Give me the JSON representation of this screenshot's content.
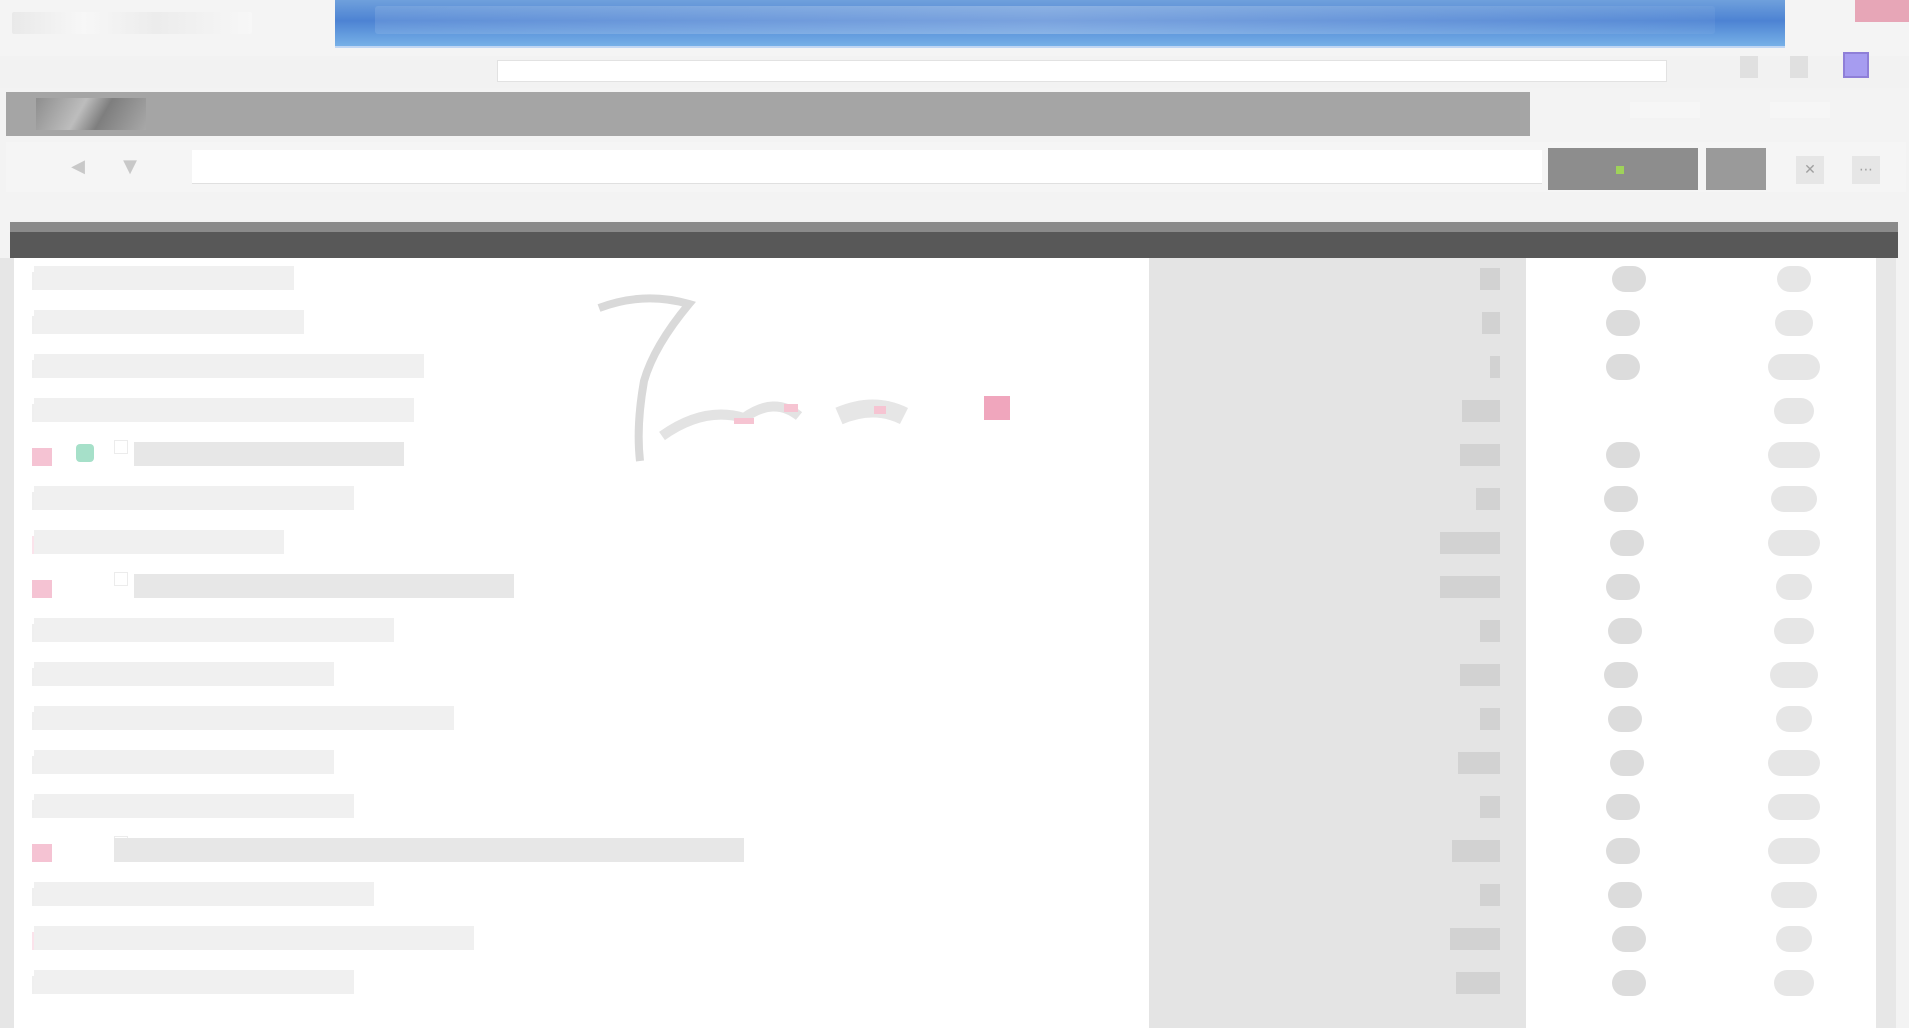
{
  "window": {
    "title": "",
    "tab_title": "",
    "tab_subtitle": ""
  },
  "colors": {
    "chrome_blue": "#4d83d3",
    "tab_bar": "#a5a5a5",
    "header_dark": "#585858",
    "accent_pink": "#f5c3d3",
    "accent_green": "#a6e0c9",
    "led_green": "#9fd25a"
  },
  "toolbar": {
    "button_primary_label": "",
    "button_secondary_label": "",
    "small_btn_1_icon": "close-icon",
    "small_btn_2_icon": "more-icon"
  },
  "content_header": {
    "label": ""
  },
  "rows": [
    {
      "text": "",
      "v1": "",
      "v2": "",
      "v3": "",
      "mark": "plain"
    },
    {
      "text": "",
      "v1": "",
      "v2": "",
      "v3": "",
      "mark": "plain"
    },
    {
      "text": "",
      "v1": "",
      "v2": "",
      "v3": "",
      "mark": "plain"
    },
    {
      "text": "",
      "v1": "",
      "v2": "",
      "v3": "",
      "mark": "plain"
    },
    {
      "text": "",
      "v1": "",
      "v2": "",
      "v3": "",
      "mark": "pink",
      "highlight": true,
      "green": true
    },
    {
      "text": "",
      "v1": "",
      "v2": "",
      "v3": "",
      "mark": "plain"
    },
    {
      "text": "",
      "v1": "",
      "v2": "",
      "v3": "",
      "mark": "pinklight"
    },
    {
      "text": "",
      "v1": "",
      "v2": "",
      "v3": "",
      "mark": "pink",
      "highlight": true
    },
    {
      "text": "",
      "v1": "",
      "v2": "",
      "v3": "",
      "mark": "plain"
    },
    {
      "text": "",
      "v1": "",
      "v2": "",
      "v3": "",
      "mark": "plain"
    },
    {
      "text": "",
      "v1": "",
      "v2": "",
      "v3": "",
      "mark": "plain"
    },
    {
      "text": "",
      "v1": "",
      "v2": "",
      "v3": "",
      "mark": "plain"
    },
    {
      "text": "",
      "v1": "",
      "v2": "",
      "v3": "",
      "mark": "plain"
    },
    {
      "text": "",
      "v1": "",
      "v2": "",
      "v3": "",
      "mark": "pink",
      "highlight": true
    },
    {
      "text": "",
      "v1": "",
      "v2": "",
      "v3": "",
      "mark": "plain"
    },
    {
      "text": "",
      "v1": "",
      "v2": "",
      "v3": "",
      "mark": "pinklight"
    },
    {
      "text": "",
      "v1": "",
      "v2": "",
      "v3": "",
      "mark": "plain"
    }
  ]
}
